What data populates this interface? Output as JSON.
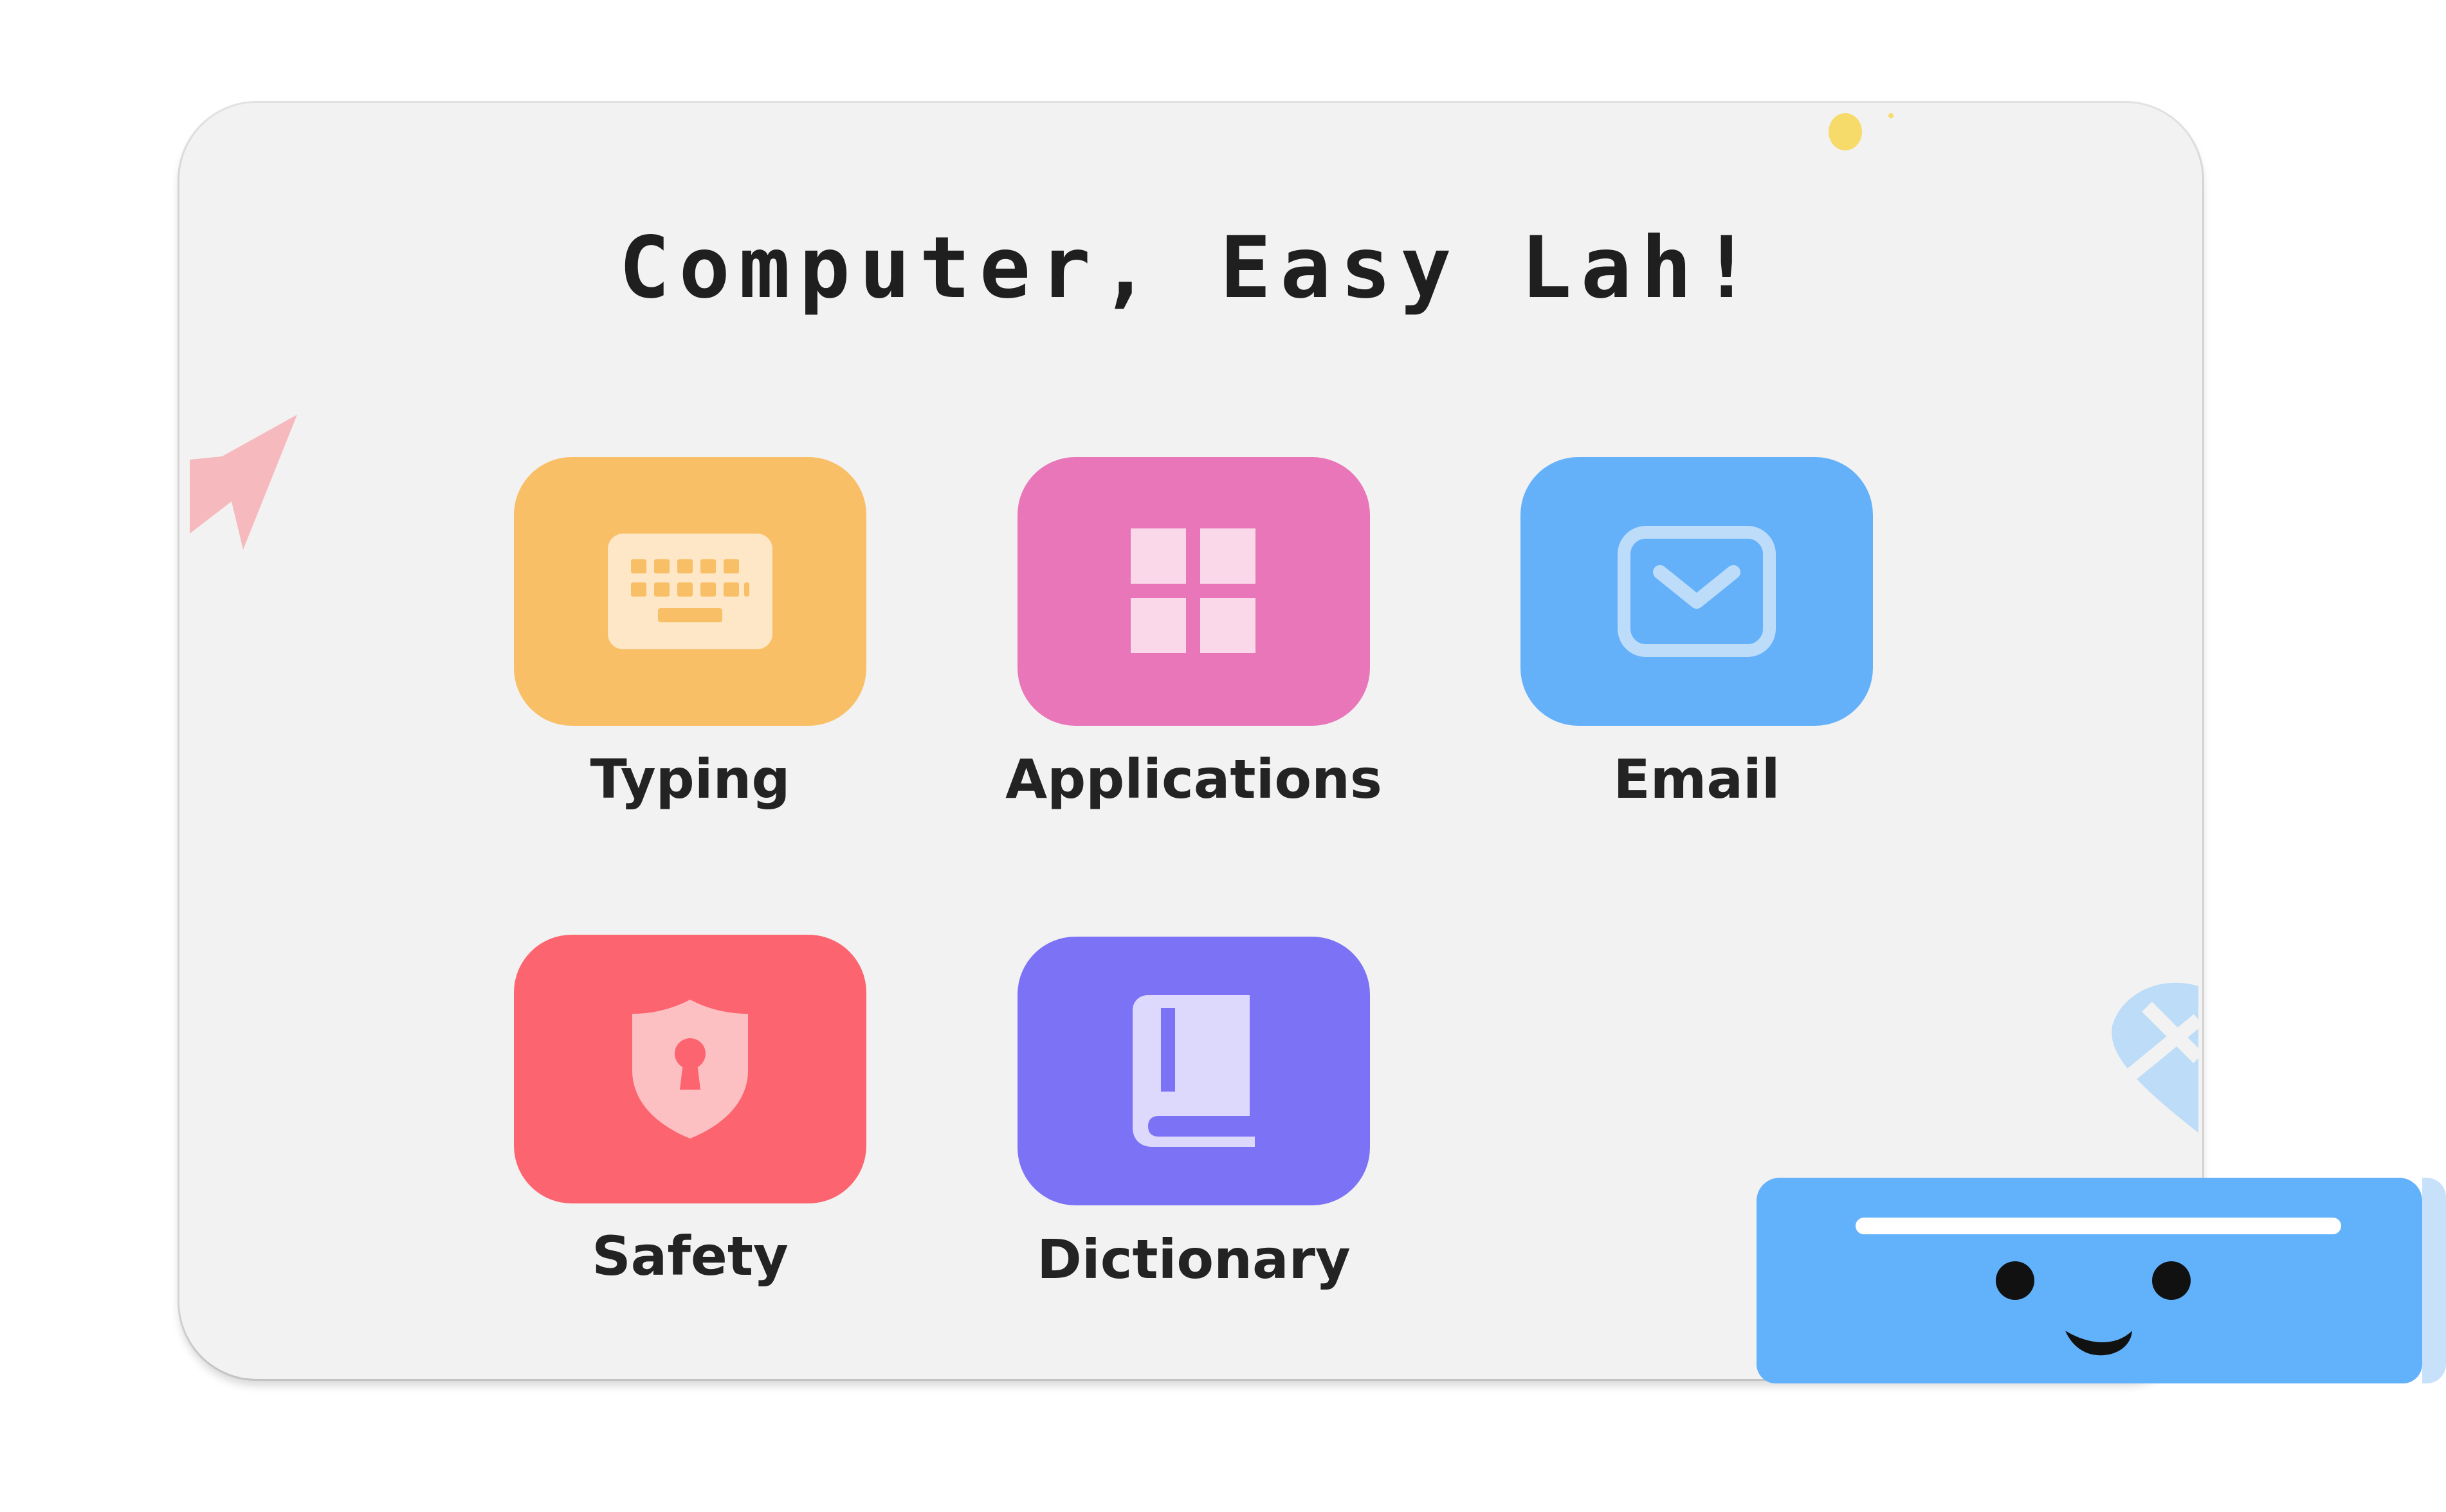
{
  "app": {
    "title": "Computer, Easy Lah!"
  },
  "menu": {
    "items": [
      {
        "label": "Typing",
        "icon": "keyboard-icon",
        "color": "#f9bf66"
      },
      {
        "label": "Applications",
        "icon": "grid-icon",
        "color": "#e876b8"
      },
      {
        "label": "Email",
        "icon": "envelope-icon",
        "color": "#64b1fa"
      },
      {
        "label": "Safety",
        "icon": "shield-lock-icon",
        "color": "#fc6570"
      },
      {
        "label": "Dictionary",
        "icon": "book-icon",
        "color": "#7b72f6"
      }
    ]
  },
  "decorations": {
    "cursor_icon": "cursor-arrow-icon",
    "mascot": "smiling-block-mascot"
  }
}
